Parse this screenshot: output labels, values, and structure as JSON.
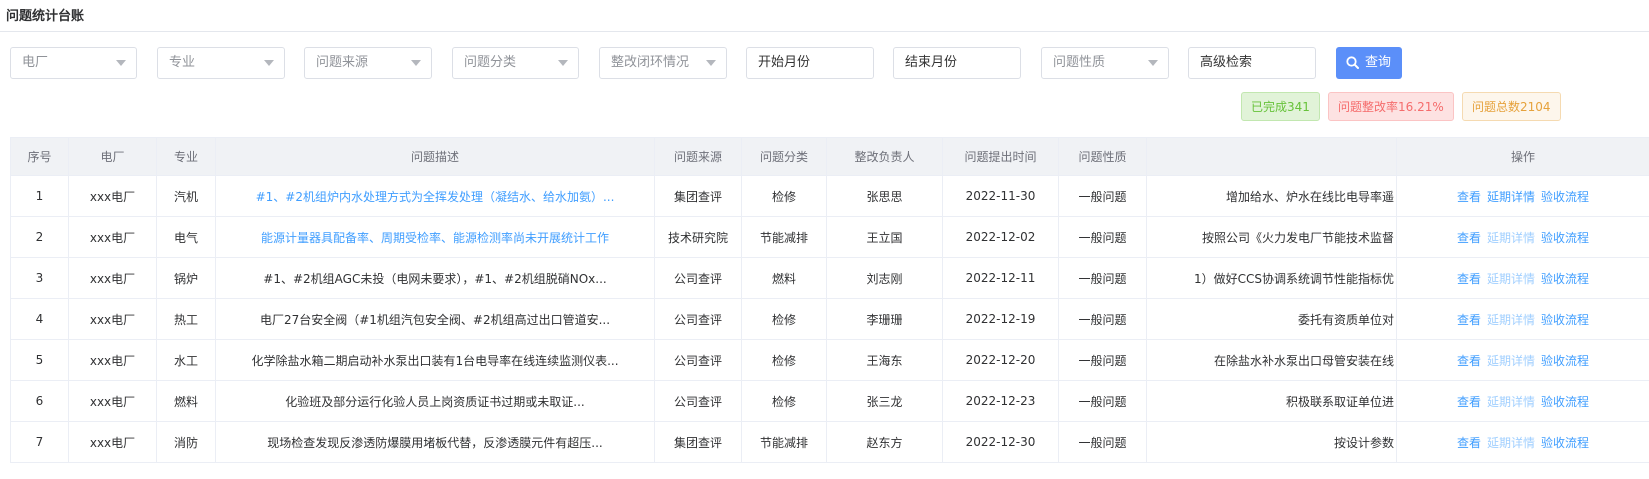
{
  "page": {
    "title": "问题统计台账"
  },
  "filters": [
    {
      "placeholder": "电厂",
      "type": "select"
    },
    {
      "placeholder": "专业",
      "type": "select"
    },
    {
      "placeholder": "问题来源",
      "type": "select"
    },
    {
      "placeholder": "问题分类",
      "type": "select"
    },
    {
      "placeholder": "整改闭环情况",
      "type": "select"
    },
    {
      "value": "开始月份",
      "type": "input"
    },
    {
      "value": "结束月份",
      "type": "input"
    },
    {
      "placeholder": "问题性质",
      "type": "select"
    },
    {
      "value": "高级检索",
      "type": "input"
    }
  ],
  "query_button": {
    "label": "查询",
    "icon": "search-icon"
  },
  "stats": {
    "completed": "已完成341",
    "rate": "问题整改率16.21%",
    "total": "问题总数2104"
  },
  "colors": {
    "accent": "#5b8ff9",
    "link": "#409eff",
    "completed_bg": "#e1f3d8",
    "completed_fg": "#67c23a",
    "rate_bg": "#fde2e2",
    "rate_fg": "#f56c6c",
    "total_bg": "#fdf6ec",
    "total_fg": "#e6a23c"
  },
  "table": {
    "columns": [
      "序号",
      "电厂",
      "专业",
      "问题描述",
      "问题来源",
      "问题分类",
      "整改负责人",
      "问题提出时间",
      "问题性质",
      "",
      "操作"
    ],
    "rows": [
      {
        "index": "1",
        "plant": "xxx电厂",
        "major": "汽机",
        "desc": "#1、#2机组炉内水处理方式为全挥发处理（凝结水、给水加氨）...",
        "desc_link": true,
        "source": "集团查评",
        "category": "检修",
        "owner": "张思思",
        "date": "2022-11-30",
        "nature": "一般问题",
        "measure": "增加给水、炉水在线比电导率遥"
      },
      {
        "index": "2",
        "plant": "xxx电厂",
        "major": "电气",
        "desc": "能源计量器具配备率、周期受检率、能源检测率尚未开展统计工作",
        "desc_link": true,
        "source": "技术研究院",
        "category": "节能减排",
        "owner": "王立国",
        "date": "2022-12-02",
        "nature": "一般问题",
        "measure": "按照公司《火力发电厂节能技术监督"
      },
      {
        "index": "3",
        "plant": "xxx电厂",
        "major": "锅炉",
        "desc": "#1、#2机组AGC未投（电网未要求），#1、#2机组脱硝NOx...",
        "desc_link": false,
        "source": "公司查评",
        "category": "燃料",
        "owner": "刘志刚",
        "date": "2022-12-11",
        "nature": "一般问题",
        "measure": "1）做好CCS协调系统调节性能指标优"
      },
      {
        "index": "4",
        "plant": "xxx电厂",
        "major": "热工",
        "desc": "电厂27台安全阀（#1机组汽包安全阀、#2机组高过出口管道安...",
        "desc_link": false,
        "source": "公司查评",
        "category": "检修",
        "owner": "李珊珊",
        "date": "2022-12-19",
        "nature": "一般问题",
        "measure": "委托有资质单位对"
      },
      {
        "index": "5",
        "plant": "xxx电厂",
        "major": "水工",
        "desc": "化学除盐水箱二期启动补水泵出口装有1台电导率在线连续监测仪表...",
        "desc_link": false,
        "source": "公司查评",
        "category": "检修",
        "owner": "王海东",
        "date": "2022-12-20",
        "nature": "一般问题",
        "measure": "在除盐水补水泵出口母管安装在线"
      },
      {
        "index": "6",
        "plant": "xxx电厂",
        "major": "燃料",
        "desc": "化验班及部分运行化验人员上岗资质证书过期或未取证...",
        "desc_link": false,
        "source": "公司查评",
        "category": "检修",
        "owner": "张三龙",
        "date": "2022-12-23",
        "nature": "一般问题",
        "measure": "积极联系取证单位进"
      },
      {
        "index": "7",
        "plant": "xxx电厂",
        "major": "消防",
        "desc": "现场检查发现反渗透防爆膜用堵板代替，反渗透膜元件有超压...",
        "desc_link": false,
        "source": "集团查评",
        "category": "节能减排",
        "owner": "赵东方",
        "date": "2022-12-30",
        "nature": "一般问题",
        "measure": "按设计参数"
      }
    ],
    "actions": {
      "view": "查看",
      "delay": "延期详情",
      "accept": "验收流程"
    }
  }
}
